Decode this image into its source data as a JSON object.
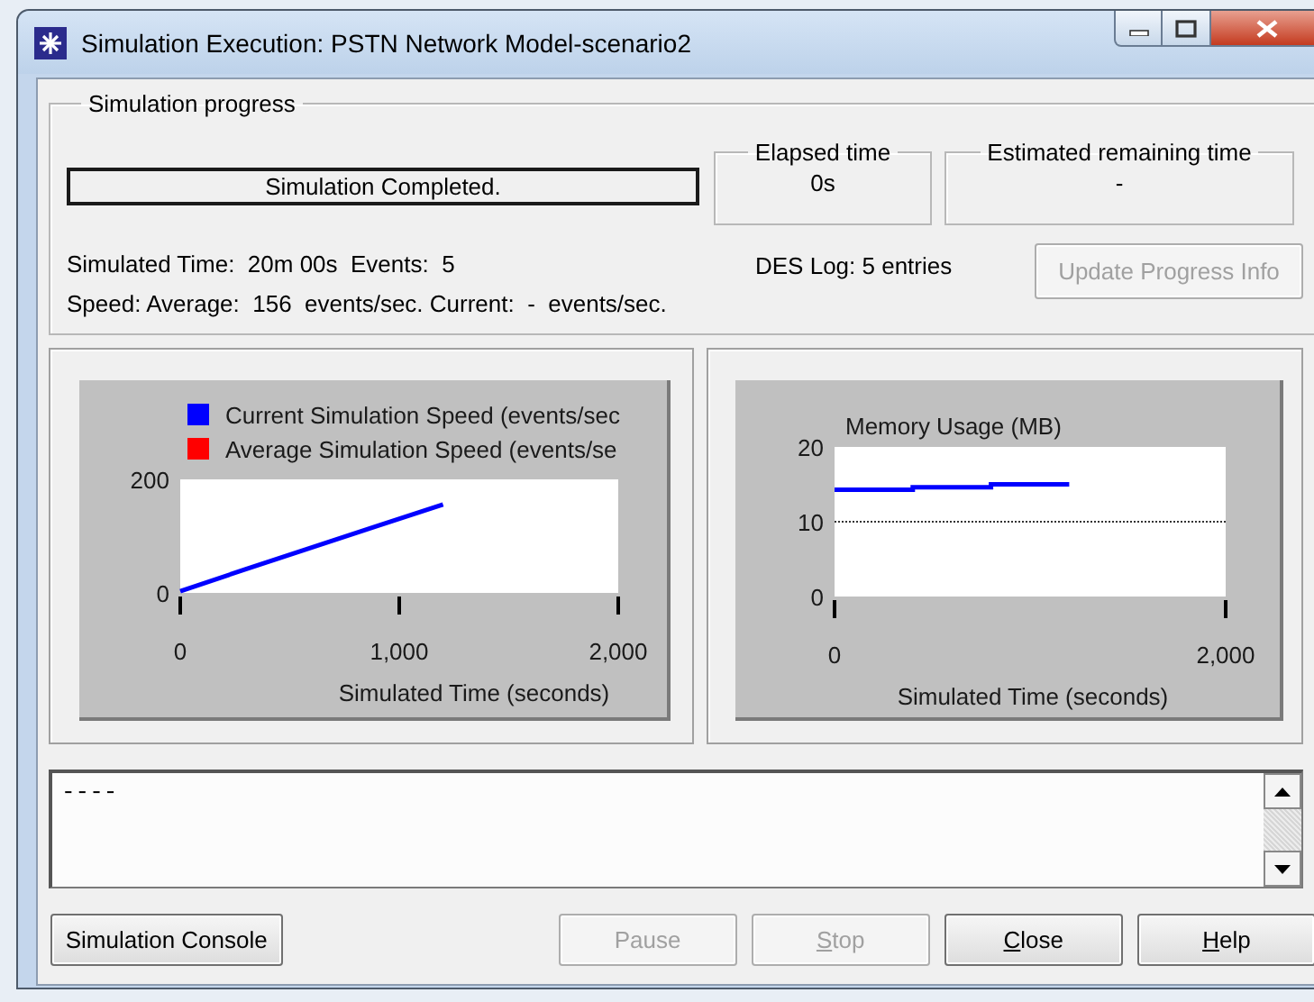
{
  "window": {
    "title": "Simulation Execution: PSTN Network Model-scenario2"
  },
  "progress": {
    "legend": "Simulation progress",
    "status": "Simulation Completed.",
    "elapsed": {
      "label": "Elapsed time",
      "value": "0s"
    },
    "remaining": {
      "label": "Estimated remaining time",
      "value": "-"
    },
    "simulated_line": "Simulated Time:  20m 00s  Events:  5",
    "speed_line": "Speed: Average:  156  events/sec. Current:  -  events/sec.",
    "des_log": "DES Log: 5 entries",
    "update_button": {
      "label": "Update Progress Info",
      "disabled": true
    }
  },
  "charts": [
    {
      "chart_data": {
        "type": "line",
        "xlim": [
          0,
          2000
        ],
        "ylim": [
          0,
          200
        ],
        "xticks": [
          {
            "value": 0,
            "label": "0"
          },
          {
            "value": 1000,
            "label": "1,000"
          },
          {
            "value": 2000,
            "label": "2,000"
          }
        ],
        "yticks": [
          0,
          200
        ],
        "xlabel": "Simulated Time (seconds)",
        "x": [
          0,
          300,
          600,
          900,
          1200
        ],
        "series": [
          {
            "name": "Current Simulation Speed (events/sec",
            "color": "#0000ff",
            "values": [
              3,
              42,
              80,
              118,
              156
            ]
          },
          {
            "name": "Average Simulation Speed (events/se",
            "color": "#ff0000",
            "values": [
              null,
              null,
              null,
              null,
              null
            ]
          }
        ]
      }
    },
    {
      "chart_data": {
        "type": "line",
        "title": "Memory Usage (MB)",
        "xlim": [
          0,
          2000
        ],
        "ylim": [
          0,
          20
        ],
        "xticks": [
          {
            "value": 0,
            "label": "0"
          },
          {
            "value": 2000,
            "label": "2,000"
          }
        ],
        "yticks": [
          0,
          10,
          20
        ],
        "xlabel": "Simulated Time (seconds)",
        "x": [
          0,
          400,
          400,
          800,
          800,
          1200,
          2000
        ],
        "series": [
          {
            "color": "#0000ff",
            "values": [
              14.3,
              14.3,
              14.6,
              14.6,
              15,
              15,
              null
            ]
          },
          {
            "color": "#333333",
            "line_style": "dotted",
            "values": [
              10,
              10,
              10,
              10,
              10,
              10,
              10
            ]
          }
        ]
      }
    }
  ],
  "log": {
    "text": "----"
  },
  "buttons": [
    {
      "label": "Simulation Console",
      "disabled": false,
      "underlined": false
    },
    {
      "label": "Pause",
      "disabled": true,
      "underlined": false
    },
    {
      "label": "Stop",
      "disabled": true,
      "underlined": true
    },
    {
      "label": "Close",
      "disabled": false,
      "underlined": true
    },
    {
      "label": "Help",
      "disabled": false,
      "underlined": true
    }
  ]
}
